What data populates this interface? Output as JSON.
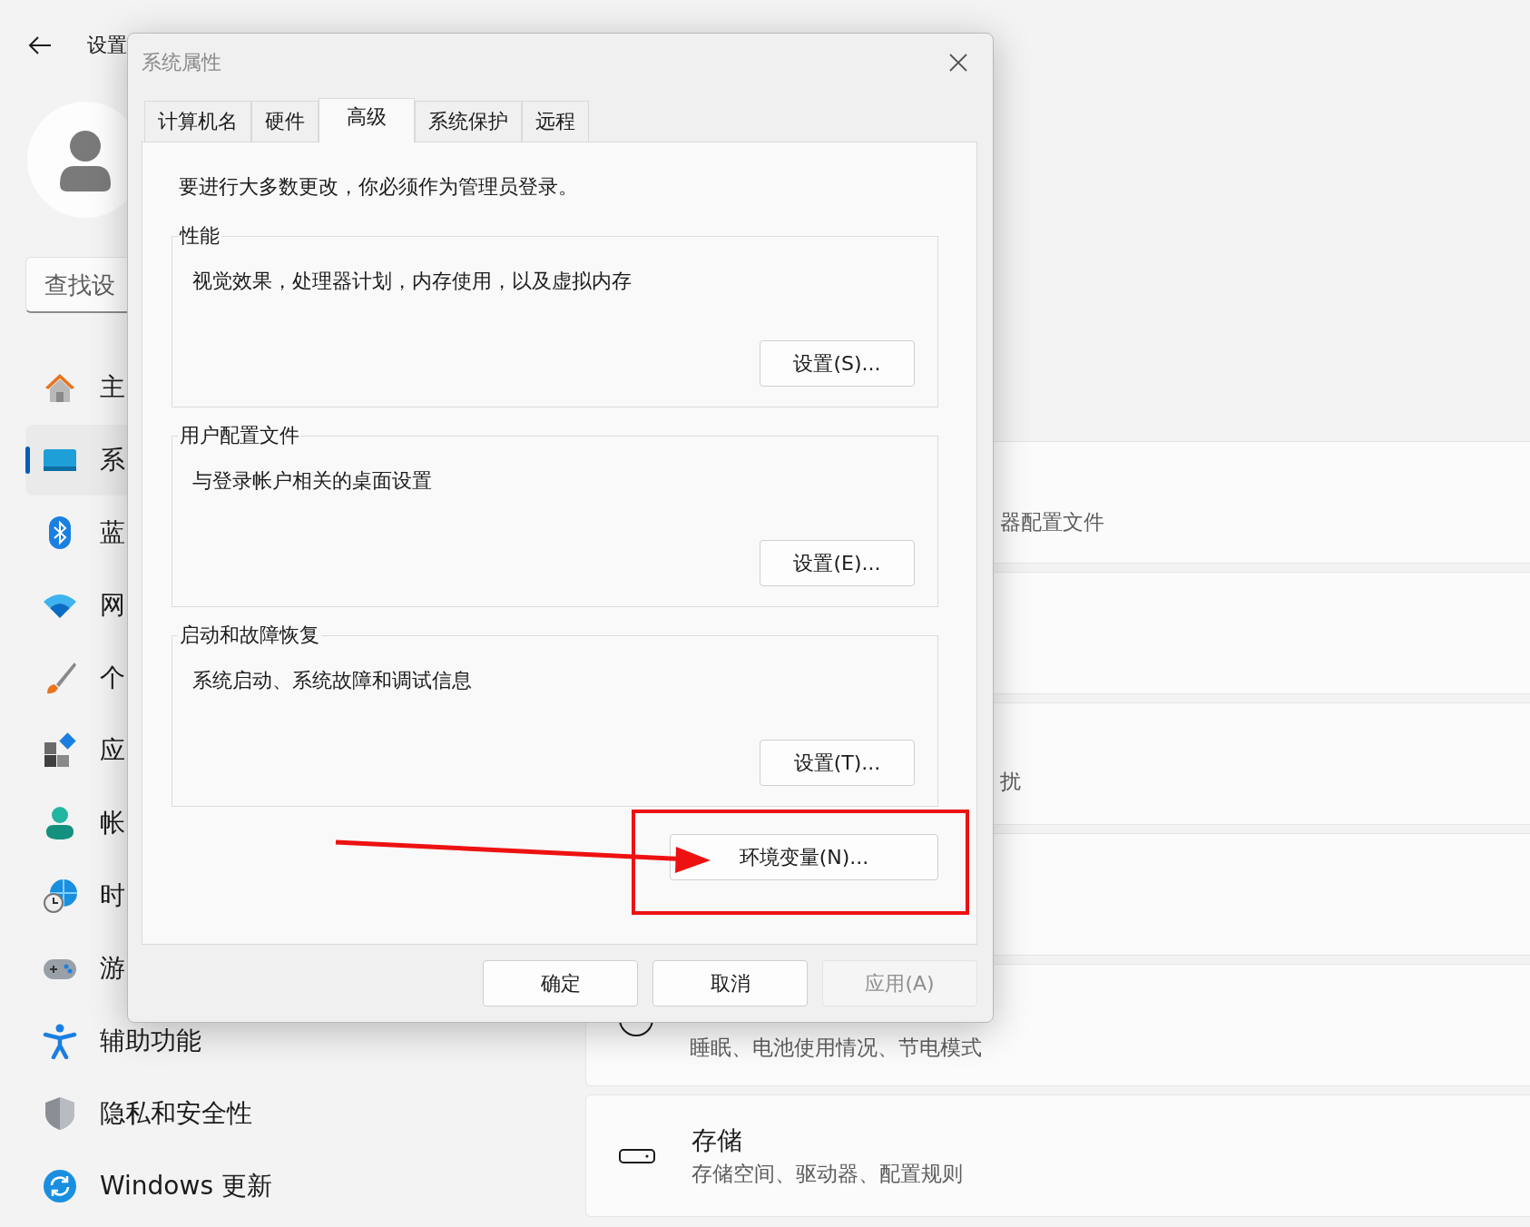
{
  "settings": {
    "title": "设置",
    "search": {
      "placeholder": "查找设"
    },
    "nav": [
      {
        "kind": "home",
        "label": "主",
        "selected": false
      },
      {
        "kind": "system",
        "label": "系",
        "selected": true
      },
      {
        "kind": "bluetooth",
        "label": "蓝",
        "selected": false
      },
      {
        "kind": "network",
        "label": "网",
        "selected": false
      },
      {
        "kind": "brush",
        "label": "个",
        "selected": false
      },
      {
        "kind": "apps",
        "label": "应",
        "selected": false
      },
      {
        "kind": "account",
        "label": "帐",
        "selected": false
      },
      {
        "kind": "time",
        "label": "时",
        "selected": false
      },
      {
        "kind": "gaming",
        "label": "游",
        "selected": false
      },
      {
        "kind": "accessibility",
        "label": "辅助功能",
        "selected": false
      },
      {
        "kind": "privacy",
        "label": "隐私和安全性",
        "selected": false
      },
      {
        "kind": "update",
        "label": "Windows 更新",
        "selected": false
      }
    ],
    "cards": [
      {
        "kind": "cut",
        "subtitle": "器配置文件"
      },
      {
        "kind": "cut"
      },
      {
        "kind": "cut",
        "subtitle": "扰"
      },
      {
        "kind": "cut"
      },
      {
        "kind": "power",
        "subtitle": "睡眠、电池使用情况、节电模式"
      },
      {
        "kind": "storage",
        "title": "存储",
        "subtitle": "存储空间、驱动器、配置规则"
      }
    ]
  },
  "dialog": {
    "title": "系统属性",
    "tabs": [
      {
        "label": "计算机名",
        "selected": false
      },
      {
        "label": "硬件",
        "selected": false
      },
      {
        "label": "高级",
        "selected": true
      },
      {
        "label": "系统保护",
        "selected": false
      },
      {
        "label": "远程",
        "selected": false
      }
    ],
    "notice": "要进行大多数更改，你必须作为管理员登录。",
    "groups": [
      {
        "legend": "性能",
        "description": "视觉效果，处理器计划，内存使用，以及虚拟内存",
        "button": "设置(S)..."
      },
      {
        "legend": "用户配置文件",
        "description": "与登录帐户相关的桌面设置",
        "button": "设置(E)..."
      },
      {
        "legend": "启动和故障恢复",
        "description": "系统启动、系统故障和调试信息",
        "button": "设置(T)..."
      }
    ],
    "env_button": "环境变量(N)...",
    "buttons": [
      {
        "label": "确定",
        "disabled": false
      },
      {
        "label": "取消",
        "disabled": false
      },
      {
        "label": "应用(A)",
        "disabled": true
      }
    ]
  }
}
